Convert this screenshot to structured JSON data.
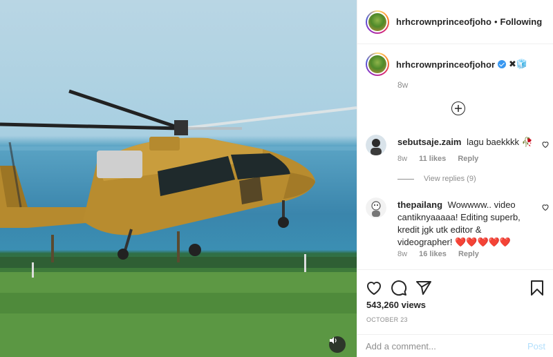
{
  "post": {
    "username": "hrhcrownprinceofjoho",
    "separator": "•",
    "follow_state": "Following"
  },
  "caption": {
    "username": "hrhcrownprinceofjohor",
    "emojis": "✖🧊",
    "time": "8w"
  },
  "comments": [
    {
      "username": "sebutsaje.zaim",
      "text": "lagu baekkkk 🥀",
      "time": "8w",
      "likes": "11 likes",
      "reply": "Reply",
      "view_replies": "View replies (9)"
    },
    {
      "username": "thepailang",
      "text": "Wowwww.. video cantiknyaaaaa! Editing superb, kredit jgk utk editor & videographer! ❤️❤️❤️❤️❤️",
      "time": "8w",
      "likes": "16 likes",
      "reply": "Reply"
    }
  ],
  "stats": {
    "views": "543,260 views",
    "date": "OCTOBER 23"
  },
  "add_comment": {
    "placeholder": "Add a comment...",
    "post_label": "Post"
  },
  "icons": {
    "like": "heart-icon",
    "comment": "comment-icon",
    "share": "paper-plane-icon",
    "save": "bookmark-icon",
    "mute": "speaker-icon",
    "more": "plus-circle-icon"
  },
  "colors": {
    "verified": "#3897f0",
    "post_disabled": "#b2dffc",
    "muted_text": "#8e8e8e",
    "heart_red": "#e0245e"
  }
}
